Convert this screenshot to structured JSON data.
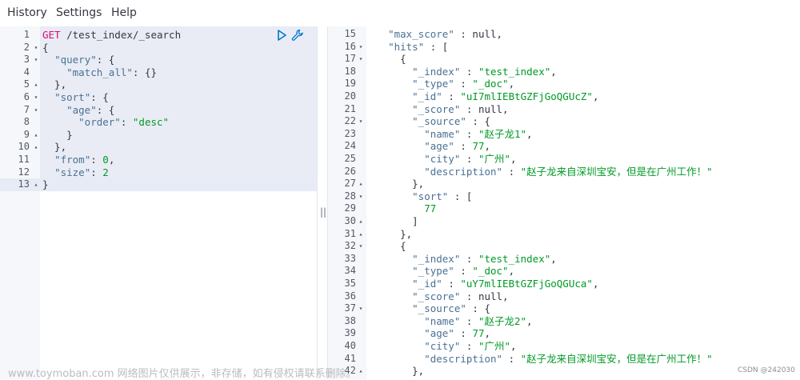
{
  "menu": {
    "history": "History",
    "settings": "Settings",
    "help": "Help"
  },
  "request": {
    "method": "GET",
    "path": " /test_index/_search",
    "lines": [
      {
        "n": "1",
        "fold": "",
        "t": [
          [
            "m",
            "GET"
          ],
          [
            "u",
            " /test_index/_search"
          ]
        ]
      },
      {
        "n": "2",
        "fold": "▾",
        "t": [
          [
            "u",
            "{"
          ]
        ]
      },
      {
        "n": "3",
        "fold": "▾",
        "t": [
          [
            "u",
            "  "
          ],
          [
            "k",
            "\"query\""
          ],
          [
            "u",
            ": {"
          ]
        ]
      },
      {
        "n": "4",
        "fold": "",
        "t": [
          [
            "u",
            "    "
          ],
          [
            "k",
            "\"match_all\""
          ],
          [
            "u",
            ": {}"
          ]
        ]
      },
      {
        "n": "5",
        "fold": "▴",
        "t": [
          [
            "u",
            "  },"
          ]
        ]
      },
      {
        "n": "6",
        "fold": "▾",
        "t": [
          [
            "u",
            "  "
          ],
          [
            "k",
            "\"sort\""
          ],
          [
            "u",
            ": {"
          ]
        ]
      },
      {
        "n": "7",
        "fold": "▾",
        "t": [
          [
            "u",
            "    "
          ],
          [
            "k",
            "\"age\""
          ],
          [
            "u",
            ": {"
          ]
        ]
      },
      {
        "n": "8",
        "fold": "",
        "t": [
          [
            "u",
            "      "
          ],
          [
            "k",
            "\"order\""
          ],
          [
            "u",
            ": "
          ],
          [
            "s",
            "\"desc\""
          ]
        ]
      },
      {
        "n": "9",
        "fold": "▴",
        "t": [
          [
            "u",
            "    }"
          ]
        ]
      },
      {
        "n": "10",
        "fold": "▴",
        "t": [
          [
            "u",
            "  },"
          ]
        ]
      },
      {
        "n": "11",
        "fold": "",
        "t": [
          [
            "u",
            "  "
          ],
          [
            "k",
            "\"from\""
          ],
          [
            "u",
            ": "
          ],
          [
            "s",
            "0"
          ],
          [
            "u",
            ","
          ]
        ]
      },
      {
        "n": "12",
        "fold": "",
        "t": [
          [
            "u",
            "  "
          ],
          [
            "k",
            "\"size\""
          ],
          [
            "u",
            ": "
          ],
          [
            "s",
            "2"
          ]
        ]
      },
      {
        "n": "13",
        "fold": "▴",
        "t": [
          [
            "u",
            "}"
          ]
        ]
      }
    ]
  },
  "response": {
    "lines": [
      {
        "n": "15",
        "fold": "",
        "t": [
          [
            "u",
            "  "
          ],
          [
            "k",
            "\"max_score\""
          ],
          [
            "u",
            " : null,"
          ]
        ]
      },
      {
        "n": "16",
        "fold": "▾",
        "t": [
          [
            "u",
            "  "
          ],
          [
            "k",
            "\"hits\""
          ],
          [
            "u",
            " : ["
          ]
        ]
      },
      {
        "n": "17",
        "fold": "▾",
        "t": [
          [
            "u",
            "    {"
          ]
        ]
      },
      {
        "n": "18",
        "fold": "",
        "t": [
          [
            "u",
            "      "
          ],
          [
            "k",
            "\"_index\""
          ],
          [
            "u",
            " : "
          ],
          [
            "s",
            "\"test_index\""
          ],
          [
            "u",
            ","
          ]
        ]
      },
      {
        "n": "19",
        "fold": "",
        "t": [
          [
            "u",
            "      "
          ],
          [
            "k",
            "\"_type\""
          ],
          [
            "u",
            " : "
          ],
          [
            "s",
            "\"_doc\""
          ],
          [
            "u",
            ","
          ]
        ]
      },
      {
        "n": "20",
        "fold": "",
        "t": [
          [
            "u",
            "      "
          ],
          [
            "k",
            "\"_id\""
          ],
          [
            "u",
            " : "
          ],
          [
            "s",
            "\"uI7mlIEBtGZFjGoQGUcZ\""
          ],
          [
            "u",
            ","
          ]
        ]
      },
      {
        "n": "21",
        "fold": "",
        "t": [
          [
            "u",
            "      "
          ],
          [
            "k",
            "\"_score\""
          ],
          [
            "u",
            " : null,"
          ]
        ]
      },
      {
        "n": "22",
        "fold": "▾",
        "t": [
          [
            "u",
            "      "
          ],
          [
            "k",
            "\"_source\""
          ],
          [
            "u",
            " : {"
          ]
        ]
      },
      {
        "n": "23",
        "fold": "",
        "t": [
          [
            "u",
            "        "
          ],
          [
            "k",
            "\"name\""
          ],
          [
            "u",
            " : "
          ],
          [
            "s",
            "\"赵子龙1\""
          ],
          [
            "u",
            ","
          ]
        ]
      },
      {
        "n": "24",
        "fold": "",
        "t": [
          [
            "u",
            "        "
          ],
          [
            "k",
            "\"age\""
          ],
          [
            "u",
            " : "
          ],
          [
            "s",
            "77"
          ],
          [
            "u",
            ","
          ]
        ]
      },
      {
        "n": "25",
        "fold": "",
        "t": [
          [
            "u",
            "        "
          ],
          [
            "k",
            "\"city\""
          ],
          [
            "u",
            " : "
          ],
          [
            "s",
            "\"广州\""
          ],
          [
            "u",
            ","
          ]
        ]
      },
      {
        "n": "26",
        "fold": "",
        "t": [
          [
            "u",
            "        "
          ],
          [
            "k",
            "\"description\""
          ],
          [
            "u",
            " : "
          ],
          [
            "s",
            "\"赵子龙来自深圳宝安，但是在广州工作！\""
          ]
        ]
      },
      {
        "n": "27",
        "fold": "▴",
        "t": [
          [
            "u",
            "      },"
          ]
        ]
      },
      {
        "n": "28",
        "fold": "▾",
        "t": [
          [
            "u",
            "      "
          ],
          [
            "k",
            "\"sort\""
          ],
          [
            "u",
            " : ["
          ]
        ]
      },
      {
        "n": "29",
        "fold": "",
        "t": [
          [
            "u",
            "        "
          ],
          [
            "s",
            "77"
          ]
        ]
      },
      {
        "n": "30",
        "fold": "▴",
        "t": [
          [
            "u",
            "      ]"
          ]
        ]
      },
      {
        "n": "31",
        "fold": "▴",
        "t": [
          [
            "u",
            "    },"
          ]
        ]
      },
      {
        "n": "32",
        "fold": "▾",
        "t": [
          [
            "u",
            "    {"
          ]
        ]
      },
      {
        "n": "33",
        "fold": "",
        "t": [
          [
            "u",
            "      "
          ],
          [
            "k",
            "\"_index\""
          ],
          [
            "u",
            " : "
          ],
          [
            "s",
            "\"test_index\""
          ],
          [
            "u",
            ","
          ]
        ]
      },
      {
        "n": "34",
        "fold": "",
        "t": [
          [
            "u",
            "      "
          ],
          [
            "k",
            "\"_type\""
          ],
          [
            "u",
            " : "
          ],
          [
            "s",
            "\"_doc\""
          ],
          [
            "u",
            ","
          ]
        ]
      },
      {
        "n": "35",
        "fold": "",
        "t": [
          [
            "u",
            "      "
          ],
          [
            "k",
            "\"_id\""
          ],
          [
            "u",
            " : "
          ],
          [
            "s",
            "\"uY7mlIEBtGZFjGoQGUca\""
          ],
          [
            "u",
            ","
          ]
        ]
      },
      {
        "n": "36",
        "fold": "",
        "t": [
          [
            "u",
            "      "
          ],
          [
            "k",
            "\"_score\""
          ],
          [
            "u",
            " : null,"
          ]
        ]
      },
      {
        "n": "37",
        "fold": "▾",
        "t": [
          [
            "u",
            "      "
          ],
          [
            "k",
            "\"_source\""
          ],
          [
            "u",
            " : {"
          ]
        ]
      },
      {
        "n": "38",
        "fold": "",
        "t": [
          [
            "u",
            "        "
          ],
          [
            "k",
            "\"name\""
          ],
          [
            "u",
            " : "
          ],
          [
            "s",
            "\"赵子龙2\""
          ],
          [
            "u",
            ","
          ]
        ]
      },
      {
        "n": "39",
        "fold": "",
        "t": [
          [
            "u",
            "        "
          ],
          [
            "k",
            "\"age\""
          ],
          [
            "u",
            " : "
          ],
          [
            "s",
            "77"
          ],
          [
            "u",
            ","
          ]
        ]
      },
      {
        "n": "40",
        "fold": "",
        "t": [
          [
            "u",
            "        "
          ],
          [
            "k",
            "\"city\""
          ],
          [
            "u",
            " : "
          ],
          [
            "s",
            "\"广州\""
          ],
          [
            "u",
            ","
          ]
        ]
      },
      {
        "n": "41",
        "fold": "",
        "t": [
          [
            "u",
            "        "
          ],
          [
            "k",
            "\"description\""
          ],
          [
            "u",
            " : "
          ],
          [
            "s",
            "\"赵子龙来自深圳宝安，但是在广州工作！\""
          ]
        ]
      },
      {
        "n": "42",
        "fold": "▴",
        "t": [
          [
            "u",
            "      },"
          ]
        ]
      }
    ]
  },
  "icons": {
    "run": "play-icon",
    "settings": "wrench-icon"
  },
  "divider_handle": "||",
  "watermark": "www.toymoban.com 网络图片仅供展示，非存储，如有侵权请联系删除。",
  "csdn_tag": "CSDN @242030"
}
